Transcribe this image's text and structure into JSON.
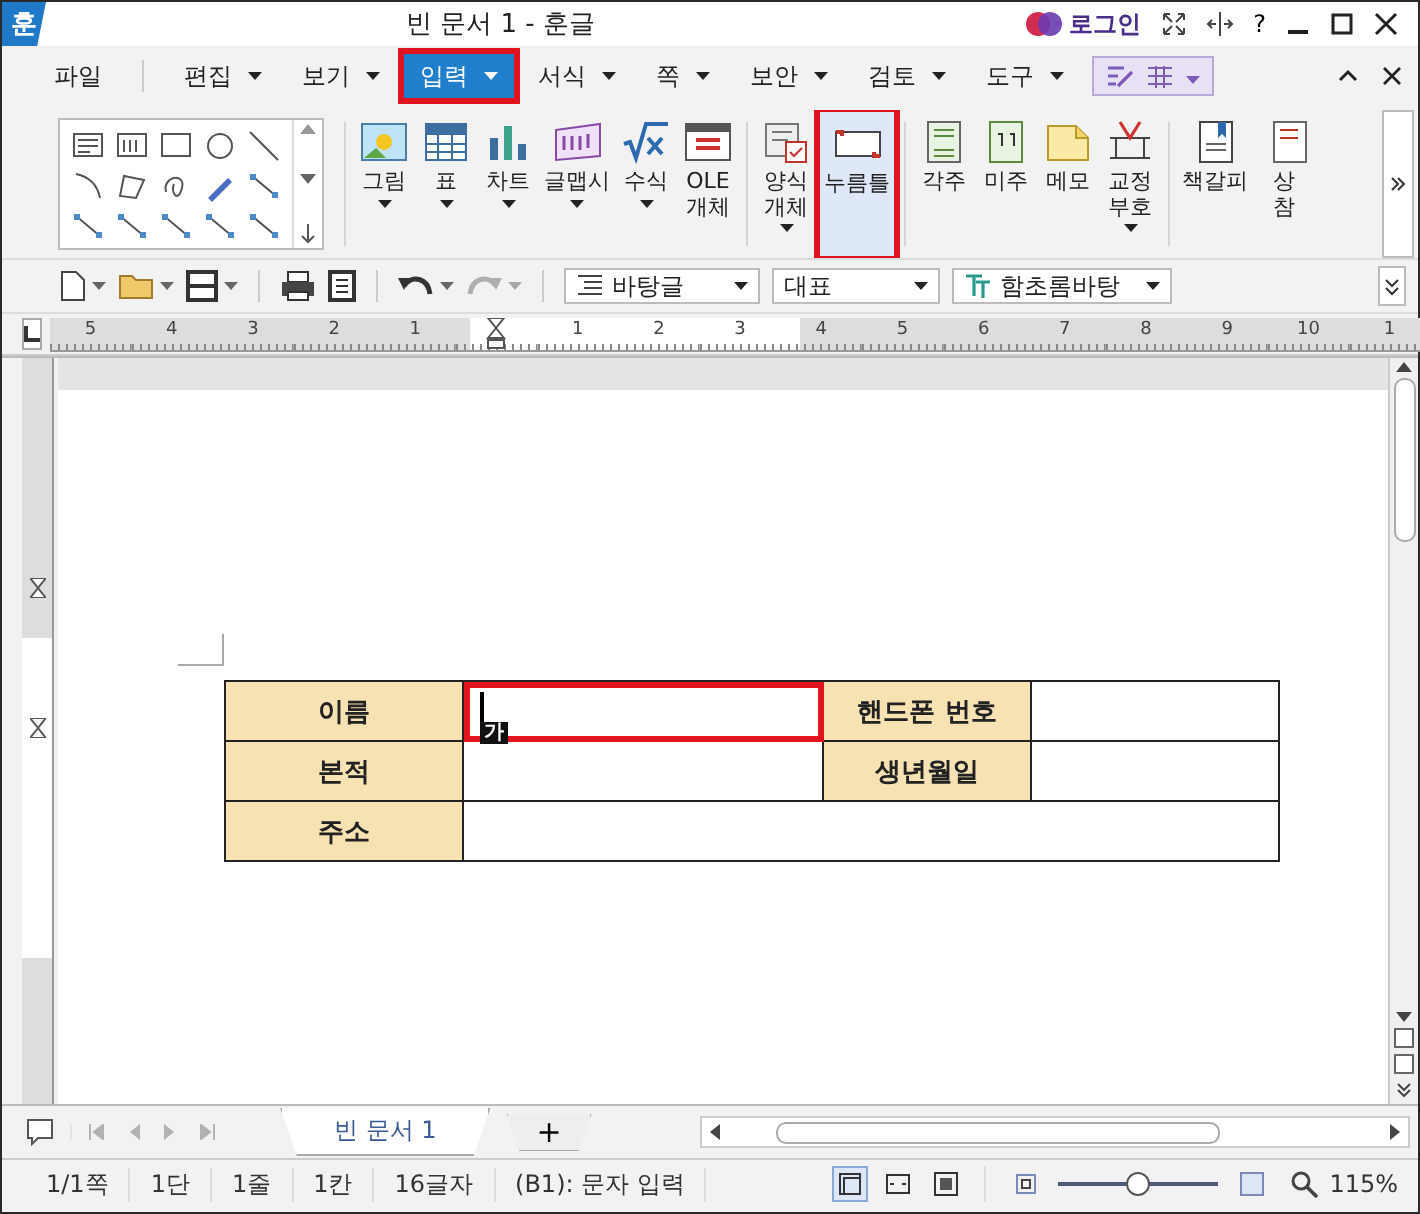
{
  "window": {
    "app_icon": "훈",
    "title": "빈 문서 1 - 훈글",
    "login": "로그인",
    "help": "?"
  },
  "menu_tabs": [
    {
      "label": "파일",
      "dropdown": false,
      "selected": false,
      "highlighted": false
    },
    {
      "label": "편집",
      "dropdown": true,
      "selected": false,
      "highlighted": false
    },
    {
      "label": "보기",
      "dropdown": true,
      "selected": false,
      "highlighted": false
    },
    {
      "label": "입력",
      "dropdown": true,
      "selected": true,
      "highlighted": true
    },
    {
      "label": "서식",
      "dropdown": true,
      "selected": false,
      "highlighted": false
    },
    {
      "label": "쪽",
      "dropdown": true,
      "selected": false,
      "highlighted": false
    },
    {
      "label": "보안",
      "dropdown": true,
      "selected": false,
      "highlighted": false
    },
    {
      "label": "검토",
      "dropdown": true,
      "selected": false,
      "highlighted": false
    },
    {
      "label": "도구",
      "dropdown": true,
      "selected": false,
      "highlighted": false
    }
  ],
  "ribbon": {
    "buttons": [
      {
        "kind": "picture",
        "label": "그림",
        "dropdown": true,
        "selected": false,
        "highlighted": false,
        "group_start": true
      },
      {
        "kind": "table",
        "label": "표",
        "dropdown": true,
        "selected": false,
        "highlighted": false,
        "group_start": false
      },
      {
        "kind": "chart",
        "label": "차트",
        "dropdown": true,
        "selected": false,
        "highlighted": false,
        "group_start": false
      },
      {
        "kind": "wordart",
        "label": "글맵시",
        "dropdown": true,
        "selected": false,
        "highlighted": false,
        "group_start": false
      },
      {
        "kind": "formula",
        "label": "수식",
        "dropdown": true,
        "selected": false,
        "highlighted": false,
        "group_start": false
      },
      {
        "kind": "ole",
        "label": "OLE\n개체",
        "dropdown": false,
        "selected": false,
        "highlighted": false,
        "group_start": false
      },
      {
        "kind": "form",
        "label": "양식\n개체",
        "dropdown": true,
        "selected": false,
        "highlighted": false,
        "group_start": true
      },
      {
        "kind": "field",
        "label": "누름틀",
        "dropdown": false,
        "selected": true,
        "highlighted": true,
        "group_start": false
      },
      {
        "kind": "footnote",
        "label": "각주",
        "dropdown": false,
        "selected": false,
        "highlighted": false,
        "group_start": true
      },
      {
        "kind": "endnote",
        "label": "미주",
        "dropdown": false,
        "selected": false,
        "highlighted": false,
        "group_start": false
      },
      {
        "kind": "memo",
        "label": "메모",
        "dropdown": false,
        "selected": false,
        "highlighted": false,
        "group_start": false
      },
      {
        "kind": "proofmark",
        "label": "교정\n부호",
        "dropdown": true,
        "selected": false,
        "highlighted": false,
        "group_start": false
      },
      {
        "kind": "bookmark",
        "label": "책갈피",
        "dropdown": false,
        "selected": false,
        "highlighted": false,
        "group_start": true
      },
      {
        "kind": "crossref",
        "label": "상\n참",
        "dropdown": false,
        "selected": false,
        "highlighted": false,
        "group_start": false
      }
    ]
  },
  "toolbar": {
    "style": "바탕글",
    "outline": "대표",
    "font": "함초롬바탕"
  },
  "ruler": {
    "left_labels": [
      "5",
      "4",
      "3",
      "2",
      "1"
    ],
    "right_labels": [
      "1",
      "2",
      "3",
      "4",
      "5",
      "6",
      "7",
      "8",
      "9",
      "10",
      "1"
    ]
  },
  "table": {
    "rows": [
      [
        {
          "kind": "header",
          "text": "이름"
        },
        {
          "kind": "value",
          "cursor": true,
          "highlighted": true,
          "ime_indicator": "가"
        },
        {
          "kind": "header",
          "text": "핸드폰 번호"
        },
        {
          "kind": "value"
        }
      ],
      [
        {
          "kind": "header",
          "text": "본적"
        },
        {
          "kind": "value"
        },
        {
          "kind": "header",
          "text": "생년월일"
        },
        {
          "kind": "value"
        }
      ],
      [
        {
          "kind": "header",
          "text": "주소"
        },
        {
          "kind": "wide"
        }
      ]
    ]
  },
  "doc_tabs": {
    "tabs": [
      {
        "label": "빈 문서 1",
        "selected": true
      }
    ],
    "add": "+"
  },
  "status_bar": {
    "items": [
      "1/1쪽",
      "1단",
      "1줄",
      "1칸",
      "16글자",
      "(B1): 문자 입력"
    ],
    "views": [
      {
        "selected": true
      },
      {
        "selected": false
      },
      {
        "selected": false
      }
    ],
    "zoom_slider": {
      "level": 0.5
    },
    "zoom": "115%"
  }
}
